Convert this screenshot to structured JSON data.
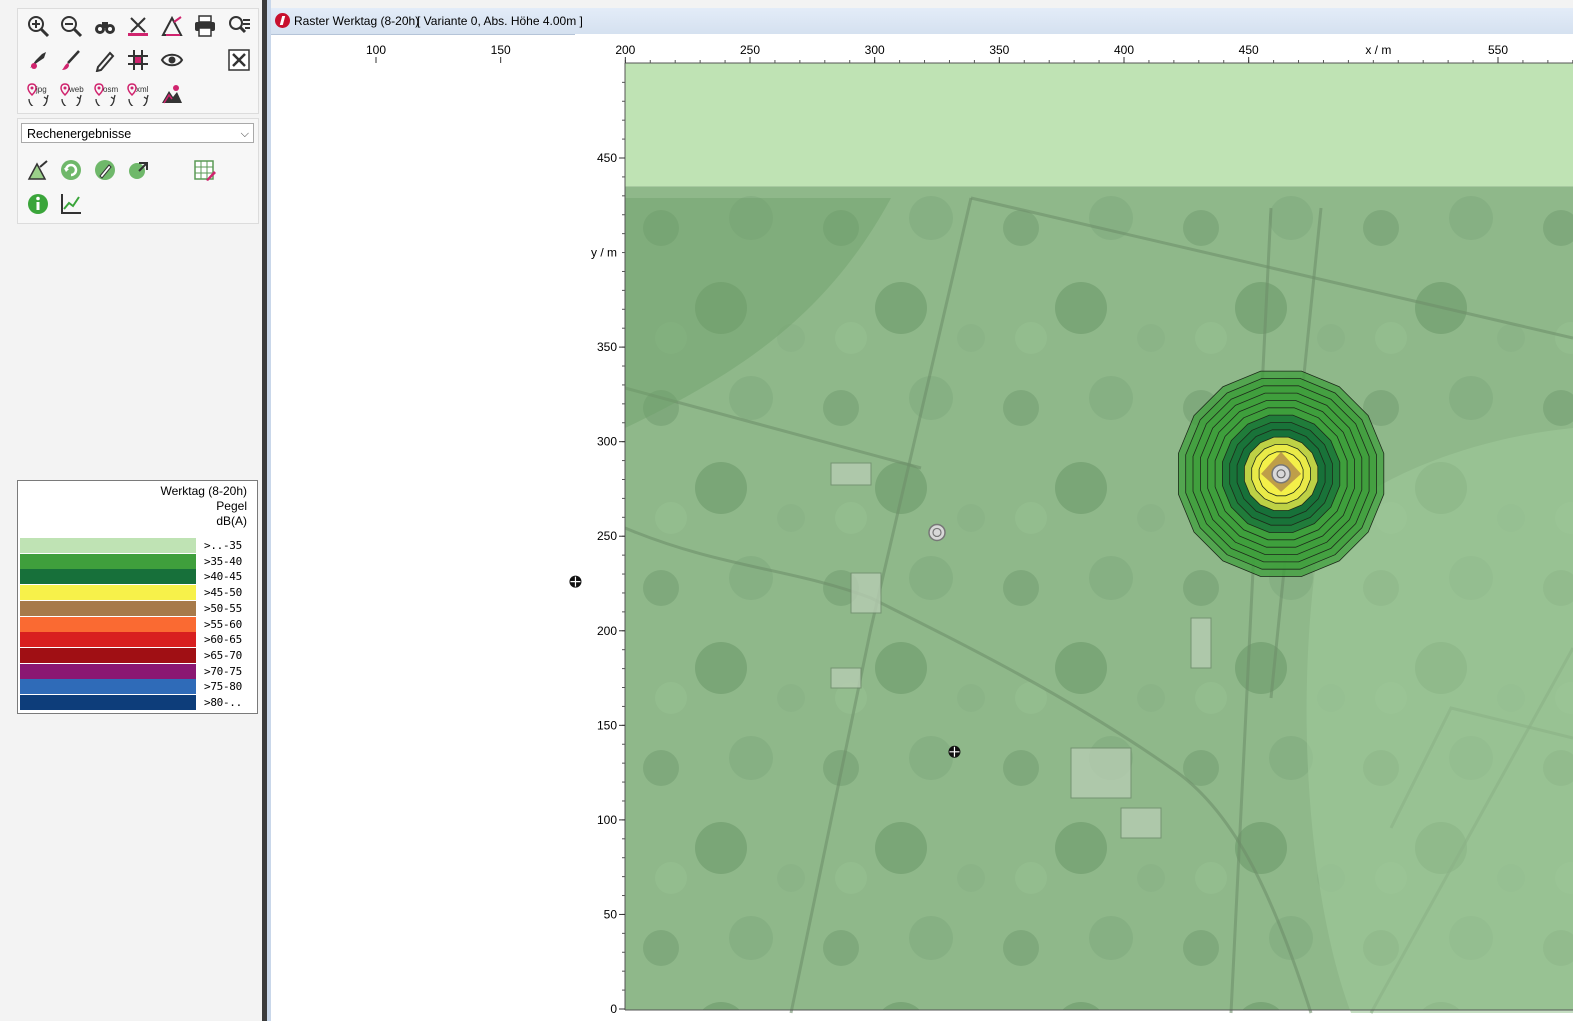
{
  "window": {
    "title": "Raster Werktag (8-20h)",
    "subtitle": "[ Variante 0, Abs. Höhe  4.00m ]"
  },
  "toolbar": {
    "rows": [
      [
        "zoom-in-icon",
        "zoom-out-icon",
        "binoculars-icon",
        "measure-icon",
        "triangle-edit-icon",
        "print-icon",
        "zoom-list-icon"
      ],
      [
        "pin-tool-icon",
        "brush-icon",
        "pencil-icon",
        "grid-icon",
        "eye-icon",
        "",
        "tools-icon"
      ],
      [
        "export-jpg-icon",
        "export-web-icon",
        "export-osm-icon",
        "export-xml-icon",
        "terrain-icon"
      ]
    ],
    "export_labels": [
      "jpg",
      "web",
      "osm",
      "xml"
    ]
  },
  "results_panel": {
    "select_value": "Rechenergebnisse",
    "tools": [
      "triangle-result-icon",
      "refresh-result-icon",
      "edit-result-icon",
      "next-result-icon",
      "table-edit-icon",
      "info-icon",
      "chart-icon"
    ]
  },
  "legend": {
    "title_line1": "Werktag (8-20h)",
    "title_line2": "Pegel",
    "title_line3": "dB(A)",
    "items": [
      {
        "label": ">..-35",
        "color": "#bfe3b4"
      },
      {
        "label": ">35-40",
        "color": "#3f9f3c"
      },
      {
        "label": ">40-45",
        "color": "#17703a"
      },
      {
        "label": ">45-50",
        "color": "#f7f14a"
      },
      {
        "label": ">50-55",
        "color": "#a77a4a"
      },
      {
        "label": ">55-60",
        "color": "#fa6a32"
      },
      {
        "label": ">60-65",
        "color": "#d81f1f"
      },
      {
        "label": ">65-70",
        "color": "#a00f14"
      },
      {
        "label": ">70-75",
        "color": "#8b1772"
      },
      {
        "label": ">75-80",
        "color": "#2f6bb8"
      },
      {
        "label": ">80-..",
        "color": "#0d3d7a"
      }
    ]
  },
  "chart_data": {
    "type": "map",
    "xlabel": "x / m",
    "ylabel": "y / m",
    "x_ticks": [
      100,
      150,
      200,
      250,
      300,
      350,
      400,
      450,
      550
    ],
    "y_ticks": [
      0,
      50,
      100,
      150,
      200,
      250,
      300,
      350,
      450
    ],
    "xlim": [
      90,
      590
    ],
    "ylim": [
      0,
      490
    ],
    "grid": false,
    "no_data_above_y": 435,
    "noise_source": {
      "x": 463,
      "y": 283,
      "outer_radius_m": 42
    },
    "receivers": [
      {
        "x": 325,
        "y": 252,
        "kind": "source"
      },
      {
        "x": 180,
        "y": 226,
        "kind": "point"
      },
      {
        "x": 332,
        "y": 136,
        "kind": "point"
      }
    ]
  }
}
